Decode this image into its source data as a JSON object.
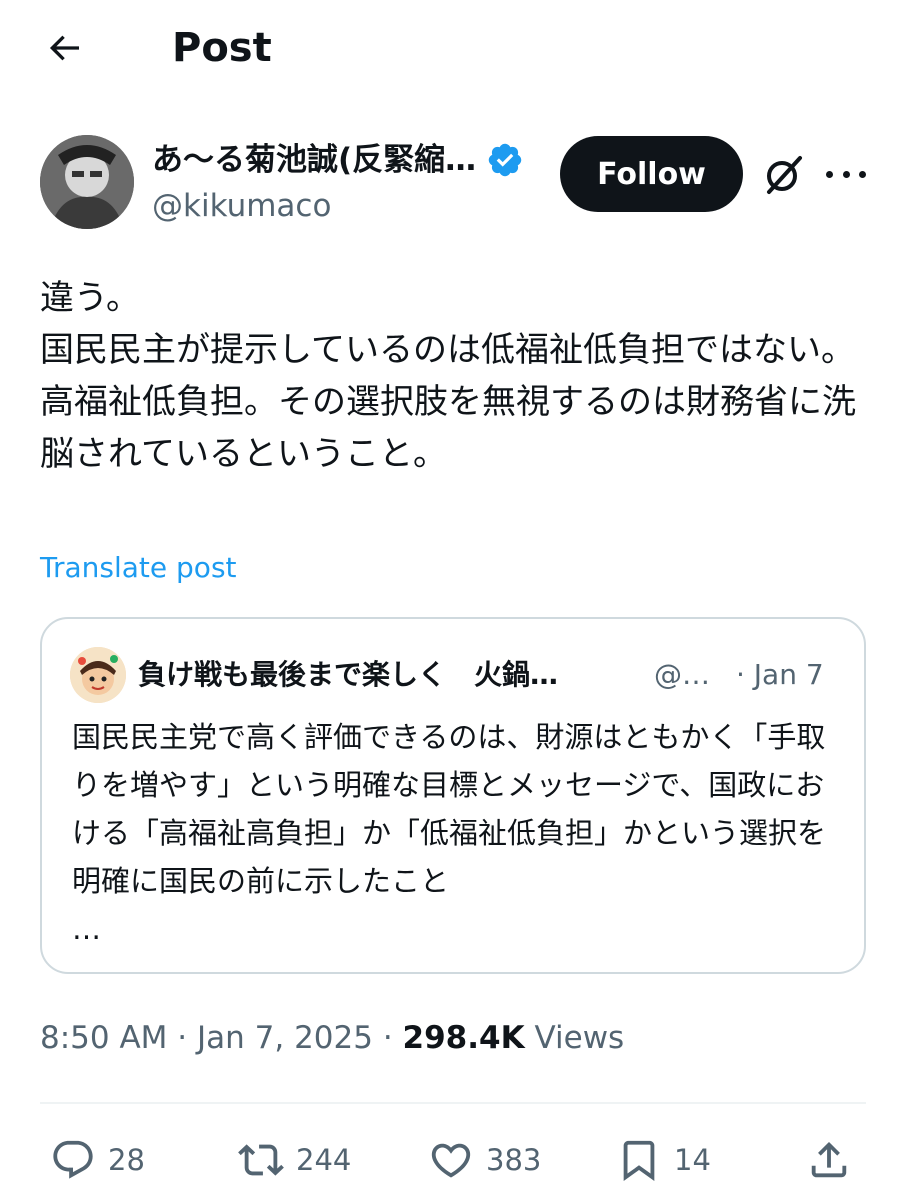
{
  "header": {
    "title": "Post"
  },
  "author": {
    "display_name": "あ〜る菊池誠(反緊縮…",
    "handle": "@kikumaco",
    "follow_label": "Follow"
  },
  "post": {
    "text": "違う。\n国民民主が提示しているのは低福祉低負担ではない。\n高福祉低負担。その選択肢を無視するのは財務省に洗脳されているということ。",
    "translate_label": "Translate post"
  },
  "quote": {
    "display_name": "負け戦も最後まで楽しく　火鍋…",
    "handle": "@…",
    "date": "· Jan 7",
    "text": "国民民主党で高く評価できるのは、財源はともかく「手取りを増やす」という明確な目標とメッセージで、国政における「高福祉高負担」か「低福祉低負担」かという選択を明確に国民の前に示したこと\n…"
  },
  "meta": {
    "time": "8:50 AM",
    "date": "Jan 7, 2025",
    "separator": "·",
    "views_count": "298.4K",
    "views_label": "Views"
  },
  "actions": {
    "replies": "28",
    "reposts": "244",
    "likes": "383",
    "bookmarks": "14"
  },
  "colors": {
    "accent": "#1d9bf0",
    "text": "#0f1419",
    "secondary": "#536471",
    "border": "#cfd9de"
  }
}
